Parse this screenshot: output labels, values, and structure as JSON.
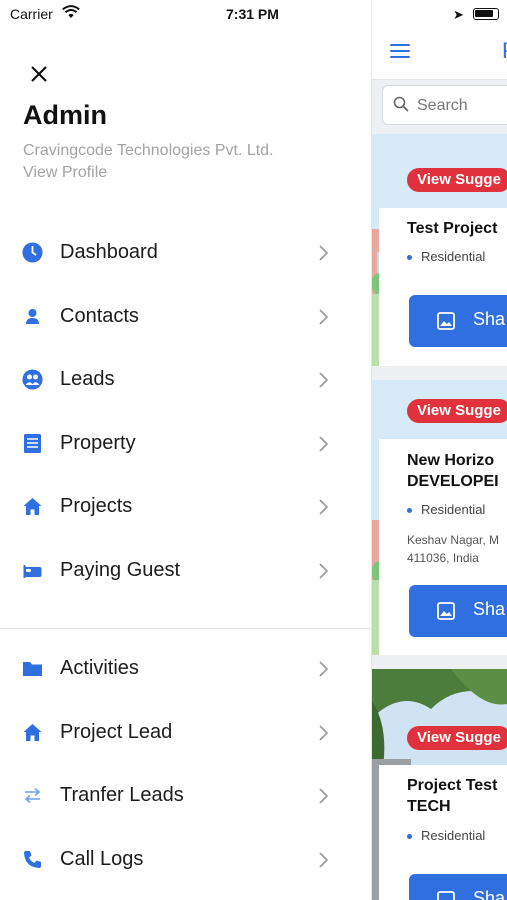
{
  "status_bar": {
    "carrier": "Carrier",
    "time": "7:31 PM"
  },
  "profile": {
    "name": "Admin",
    "company": "Cravingcode Technologies Pvt. Ltd.",
    "view_profile": "View Profile"
  },
  "menu": {
    "primary": [
      {
        "label": "Dashboard",
        "icon": "dashboard-icon"
      },
      {
        "label": "Contacts",
        "icon": "contact-person-icon"
      },
      {
        "label": "Leads",
        "icon": "leads-group-icon"
      },
      {
        "label": "Property",
        "icon": "property-document-icon"
      },
      {
        "label": "Projects",
        "icon": "home-icon"
      },
      {
        "label": "Paying Guest",
        "icon": "bed-icon"
      }
    ],
    "secondary": [
      {
        "label": "Activities",
        "icon": "folder-icon"
      },
      {
        "label": "Project Lead",
        "icon": "home-icon"
      },
      {
        "label": "Tranfer Leads",
        "icon": "transfer-arrows-icon"
      },
      {
        "label": "Call Logs",
        "icon": "phone-icon"
      }
    ]
  },
  "background_app": {
    "header_letter": "P",
    "search_placeholder": "Search",
    "cards": [
      {
        "badge": "View Sugge",
        "title_lines": [
          "Test Project"
        ],
        "chip": "Residential",
        "address_lines": [],
        "button": "Sha"
      },
      {
        "badge": "View Sugge",
        "title_lines": [
          "New Horizo",
          "DEVELOPEI"
        ],
        "chip": "Residential",
        "address_lines": [
          "Keshav Nagar, M",
          "411036, India"
        ],
        "button": "Sha"
      },
      {
        "badge": "View Sugge",
        "title_lines": [
          "Project Test",
          "TECH"
        ],
        "chip": "Residential",
        "address_lines": [],
        "button": "Sha"
      }
    ]
  },
  "colors": {
    "accent": "#2f6fe0",
    "badge_red": "#e0313d",
    "muted_text": "#a3a3a3"
  }
}
